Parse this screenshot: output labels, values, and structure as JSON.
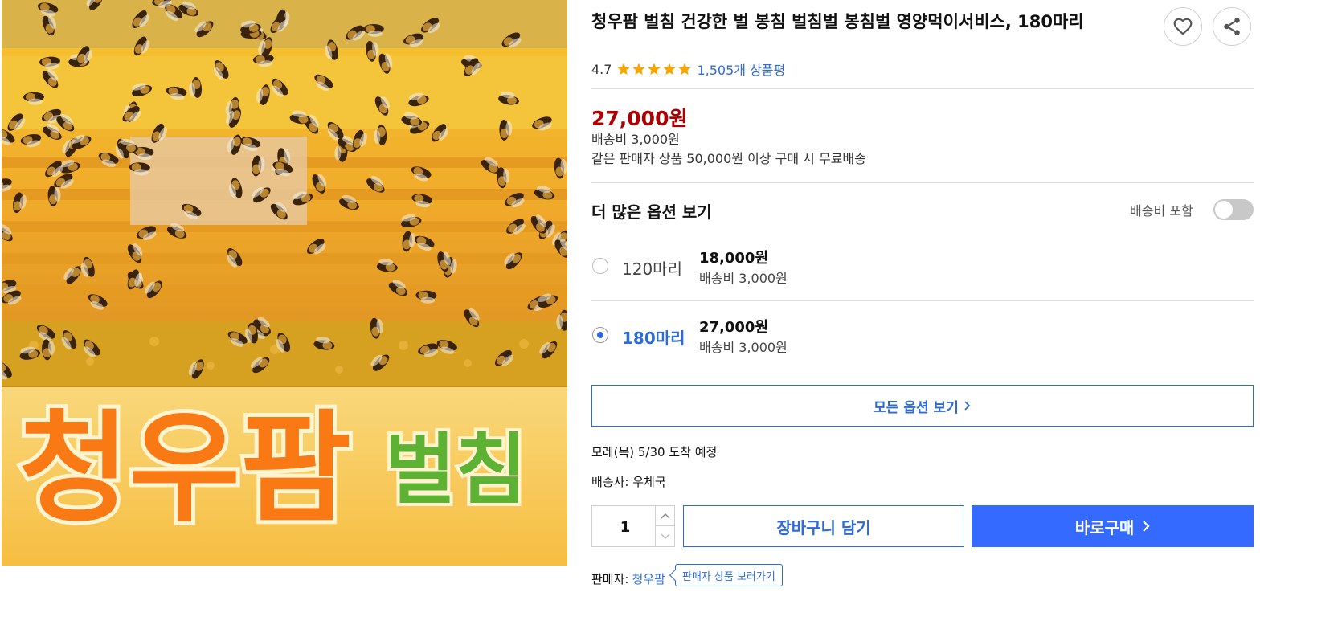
{
  "product": {
    "title": "청우팜 벌침 건강한 벌 봉침 벌침벌 봉침벌 영양먹이서비스, 180마리",
    "image_text": {
      "brand": "청우팜",
      "word": "벌침"
    },
    "rating": "4.7",
    "stars": 5,
    "review_count": "1,505개 상품평",
    "price": "27,000원",
    "shipping_fee": "배송비 3,000원",
    "free_shipping_note": "같은 판매자 상품 50,000원 이상 구매 시 무료배송"
  },
  "actions": {
    "wish_icon": "heart-icon",
    "share_icon": "share-icon"
  },
  "options": {
    "header": "더 많은 옵션 보기",
    "toggle_label": "배송비 포함",
    "toggle_on": false,
    "items": [
      {
        "name": "120마리",
        "price": "18,000원",
        "shipping": "배송비 3,000원",
        "selected": false
      },
      {
        "name": "180마리",
        "price": "27,000원",
        "shipping": "배송비 3,000원",
        "selected": true
      }
    ],
    "all_options_label": "모든 옵션 보기"
  },
  "delivery": {
    "arrival": "모레(목) 5/30 도착 예정",
    "carrier": "배송사: 우체국"
  },
  "purchase": {
    "quantity": "1",
    "cart_label": "장바구니 담기",
    "buy_label": "바로구매"
  },
  "seller": {
    "label": "판매자:",
    "name": "청우팜",
    "tooltip": "판매자 상품 보러가기"
  },
  "colors": {
    "accent": "#346aff",
    "link": "#2d6bd8",
    "price": "#ae0000",
    "star": "#f7a600"
  }
}
